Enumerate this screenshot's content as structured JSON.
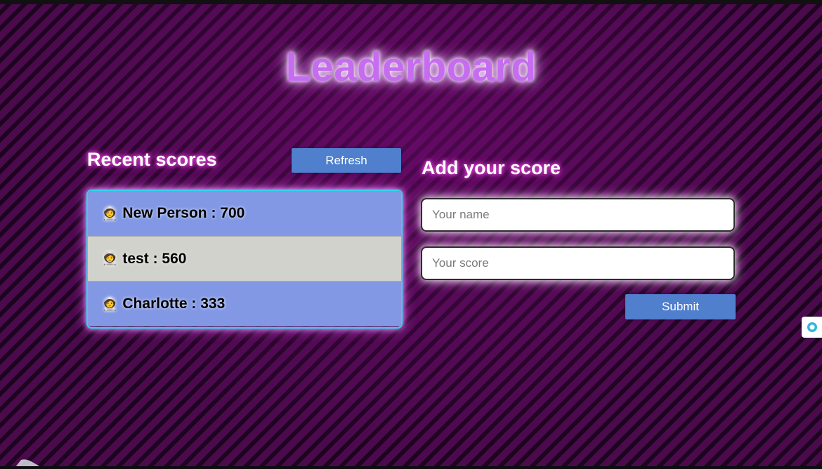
{
  "page": {
    "title": "Leaderboard"
  },
  "recent": {
    "heading": "Recent scores",
    "refresh_label": "Refresh",
    "scores": [
      {
        "avatar": "🧑‍🚀",
        "text": "New Person : 700"
      },
      {
        "avatar": "🧑‍🚀",
        "text": "test : 560"
      },
      {
        "avatar": "🧑‍🚀",
        "text": "Charlotte : 333"
      }
    ]
  },
  "add_score": {
    "heading": "Add your score",
    "name_placeholder": "Your name",
    "name_value": "",
    "score_placeholder": "Your score",
    "score_value": "",
    "submit_label": "Submit"
  },
  "colors": {
    "title": "#c56cf0",
    "button": "#4f7fcd",
    "row_odd": "#8298e5",
    "row_even": "#d1d2cb",
    "list_border": "#2fd5ef"
  },
  "icons": {
    "avatar": "astronaut-icon",
    "side_widget": "assistant-icon"
  }
}
